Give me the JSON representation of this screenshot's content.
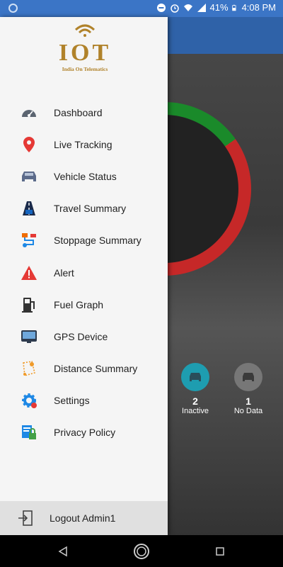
{
  "status_bar": {
    "battery": "41%",
    "time": "4:08 PM"
  },
  "logo": {
    "title": "IOT",
    "tagline": "India On Telematics"
  },
  "menu": [
    {
      "label": "Dashboard",
      "icon": "speedometer-icon"
    },
    {
      "label": "Live Tracking",
      "icon": "map-pin-icon"
    },
    {
      "label": "Vehicle Status",
      "icon": "car-icon"
    },
    {
      "label": "Travel Summary",
      "icon": "road-car-icon"
    },
    {
      "label": "Stoppage Summary",
      "icon": "route-icon"
    },
    {
      "label": "Alert",
      "icon": "warning-icon"
    },
    {
      "label": "Fuel Graph",
      "icon": "fuel-pump-icon"
    },
    {
      "label": "GPS Device",
      "icon": "gps-device-icon"
    },
    {
      "label": "Distance Summary",
      "icon": "distance-icon"
    },
    {
      "label": "Settings",
      "icon": "settings-icon"
    },
    {
      "label": "Privacy Policy",
      "icon": "privacy-icon"
    }
  ],
  "logout": {
    "label": "Logout Admin1"
  },
  "background": {
    "inactive_count": "2",
    "inactive_label": "Inactive",
    "nodata_count": "1",
    "nodata_label": "No Data"
  },
  "colors": {
    "status_bar": "#3b75c6",
    "brand": "#b0822a",
    "drawer_bg": "#f5f5f5",
    "logout_bg": "#e0e0e0"
  }
}
